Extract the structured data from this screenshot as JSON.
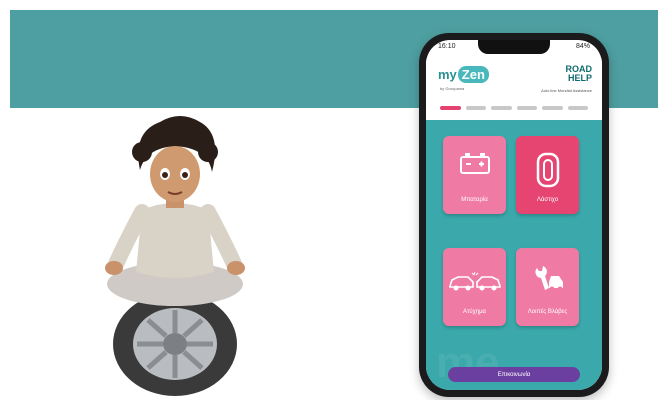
{
  "colors": {
    "band": "#4e9fa1",
    "tile_pink": "#ef7aa3",
    "tile_active": "#e64471",
    "content_teal": "#3ba8ab",
    "button": "#6b3fa0"
  },
  "status": {
    "time": "16:10",
    "battery": "84%"
  },
  "brand": {
    "logo_my": "my",
    "logo_zen": "Zen",
    "logo_sub": "by Groupama",
    "roadhelp_line1": "ROAD",
    "roadhelp_line2": "HELP",
    "roadhelp_sub": "Auto line Mondial Assistance"
  },
  "tabs_count": 6,
  "tiles": [
    {
      "label": "Μπαταρία",
      "icon": "battery-icon"
    },
    {
      "label": "Λάστιχο",
      "icon": "tire-icon"
    },
    {
      "label": "Ατύχημα",
      "icon": "car-crash-icon"
    },
    {
      "label": "Λοιπές Βλάβες",
      "icon": "wrench-car-icon"
    }
  ],
  "contact_label": "Επικοινωνία"
}
